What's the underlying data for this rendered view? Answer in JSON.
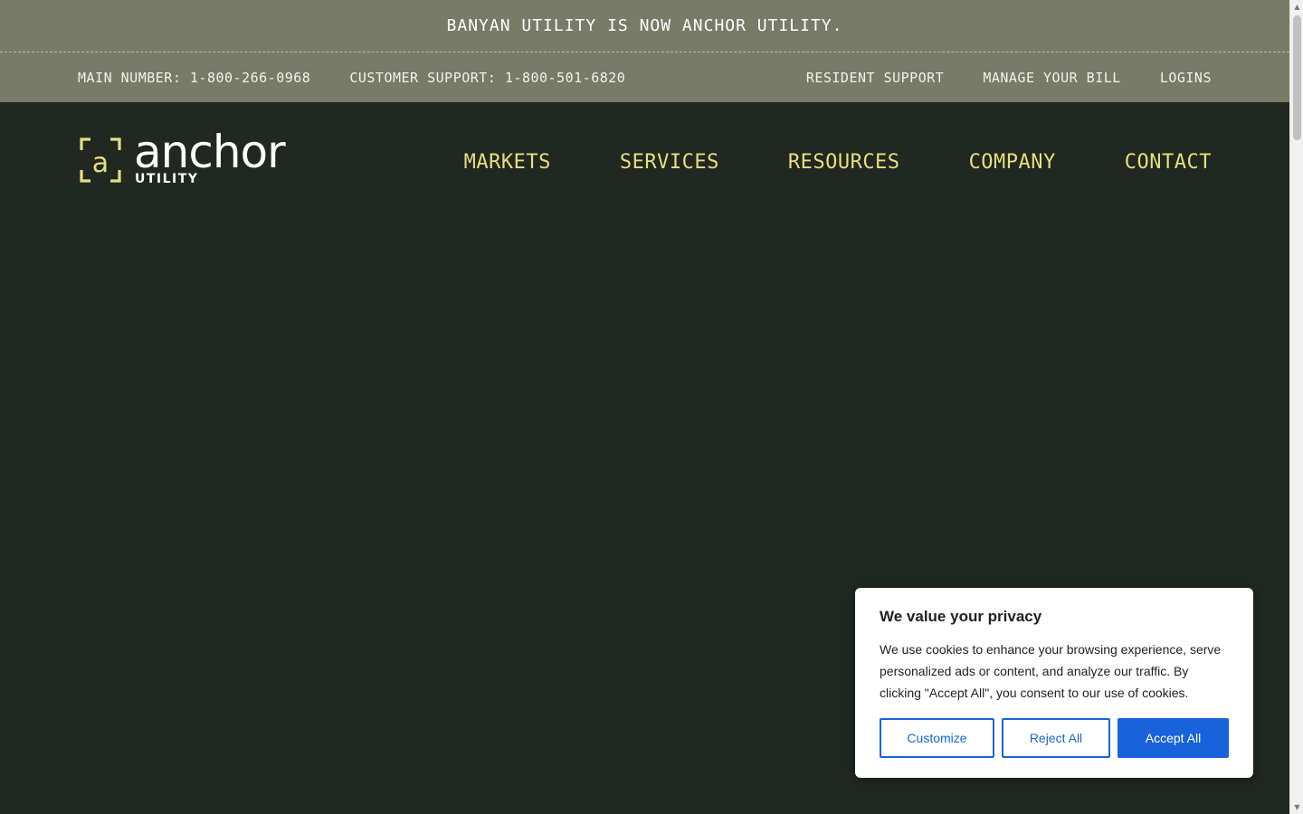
{
  "announcement": {
    "text": "BANYAN UTILITY IS NOW ANCHOR UTILITY."
  },
  "utility_bar": {
    "main_number": "MAIN NUMBER: 1-800-266-0968",
    "customer_support": "CUSTOMER SUPPORT: 1-800-501-6820",
    "links": {
      "resident_support": "RESIDENT SUPPORT",
      "manage_bill": "MANAGE YOUR BILL",
      "logins": "LOGINS"
    }
  },
  "logo": {
    "word": "anchor",
    "sub": "UTILITY",
    "mark_letter": "a"
  },
  "nav": {
    "markets": "MARKETS",
    "services": "SERVICES",
    "resources": "RESOURCES",
    "company": "COMPANY",
    "contact": "CONTACT"
  },
  "cookie": {
    "title": "We value your privacy",
    "text": "We use cookies to enhance your browsing experience, serve personalized ads or content, and analyze our traffic. By clicking \"Accept All\", you consent to our use of cookies.",
    "customize": "Customize",
    "reject": "Reject All",
    "accept": "Accept All"
  },
  "colors": {
    "topbar": "#787b65",
    "background": "#212721",
    "nav_accent": "#e8df7b",
    "button_blue": "#1863dc"
  },
  "icons": {
    "scroll_up": "scroll-up-arrow-icon",
    "scroll_down": "scroll-down-arrow-icon"
  }
}
